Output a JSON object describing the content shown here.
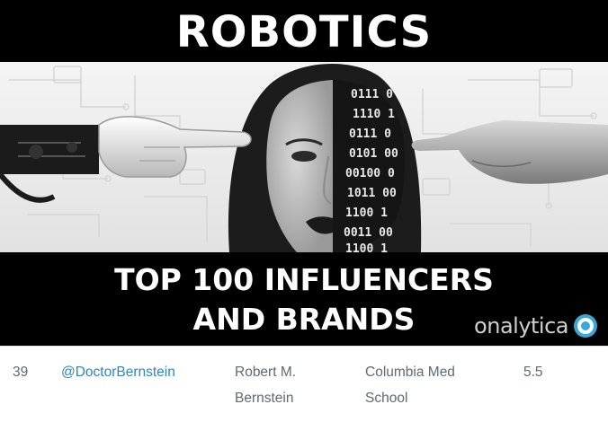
{
  "banner": {
    "title": "ROBOTICS",
    "subtitle_line1": "TOP 100 INFLUENCERS",
    "subtitle_line2": "AND BRANDS",
    "logo_text": "onalytica",
    "logo_icon": "onalytica-ring-icon",
    "logo_color": "#3aa7d9",
    "photo_binary": [
      "0111 0",
      "1110 1",
      "0111 0",
      "0101 00",
      "00100 0",
      "1011 00",
      "1100 1",
      "0011 00",
      "1100 1"
    ]
  },
  "table": {
    "rows": [
      {
        "rank": "39",
        "handle": "@DoctorBernstein",
        "name": "Robert M. Bernstein",
        "organization": "Columbia Med School",
        "score": "5.5"
      }
    ]
  },
  "colors": {
    "banner_bg": "#000000",
    "link": "#2e86c1",
    "text": "#5f6a72"
  }
}
